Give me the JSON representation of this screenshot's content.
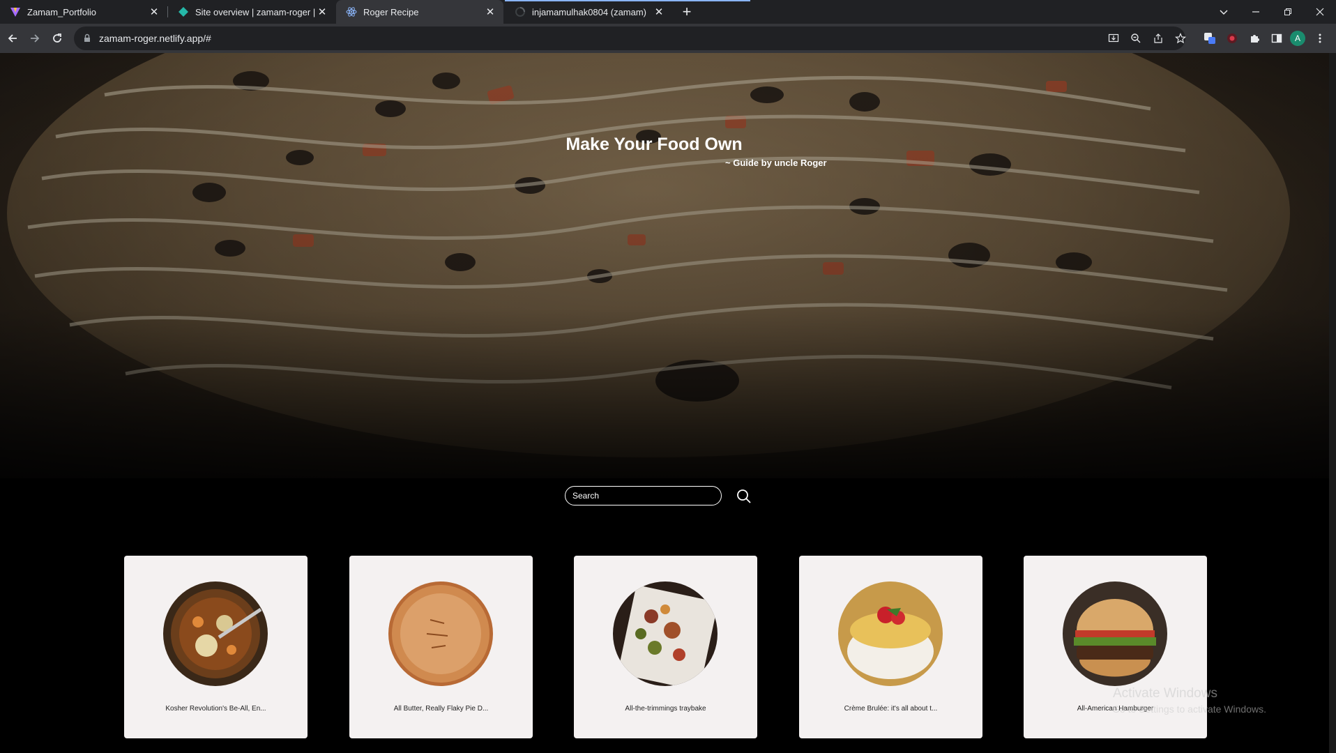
{
  "browser": {
    "tabs": [
      {
        "title": "Zamam_Portfolio",
        "active": false
      },
      {
        "title": "Site overview | zamam-roger | N",
        "active": false
      },
      {
        "title": "Roger Recipe",
        "active": true
      },
      {
        "title": "injamamulhak0804 (zamam)",
        "active": false
      }
    ],
    "url": "zamam-roger.netlify.app/#",
    "profile_initial": "A"
  },
  "hero": {
    "title": "Make Your Food Own",
    "subtitle": "~ Guide by uncle Roger"
  },
  "search": {
    "placeholder": "Search"
  },
  "recipes": [
    {
      "caption": "Kosher Revolution's Be-All, En..."
    },
    {
      "caption": "All Butter, Really Flaky Pie D..."
    },
    {
      "caption": "All-the-trimmings traybake"
    },
    {
      "caption": "Crème Brulée: it's all about t..."
    },
    {
      "caption": "All-American Hamburger"
    }
  ],
  "os": {
    "activate_title": "Activate Windows",
    "activate_sub": "Go to Settings to activate Windows."
  }
}
